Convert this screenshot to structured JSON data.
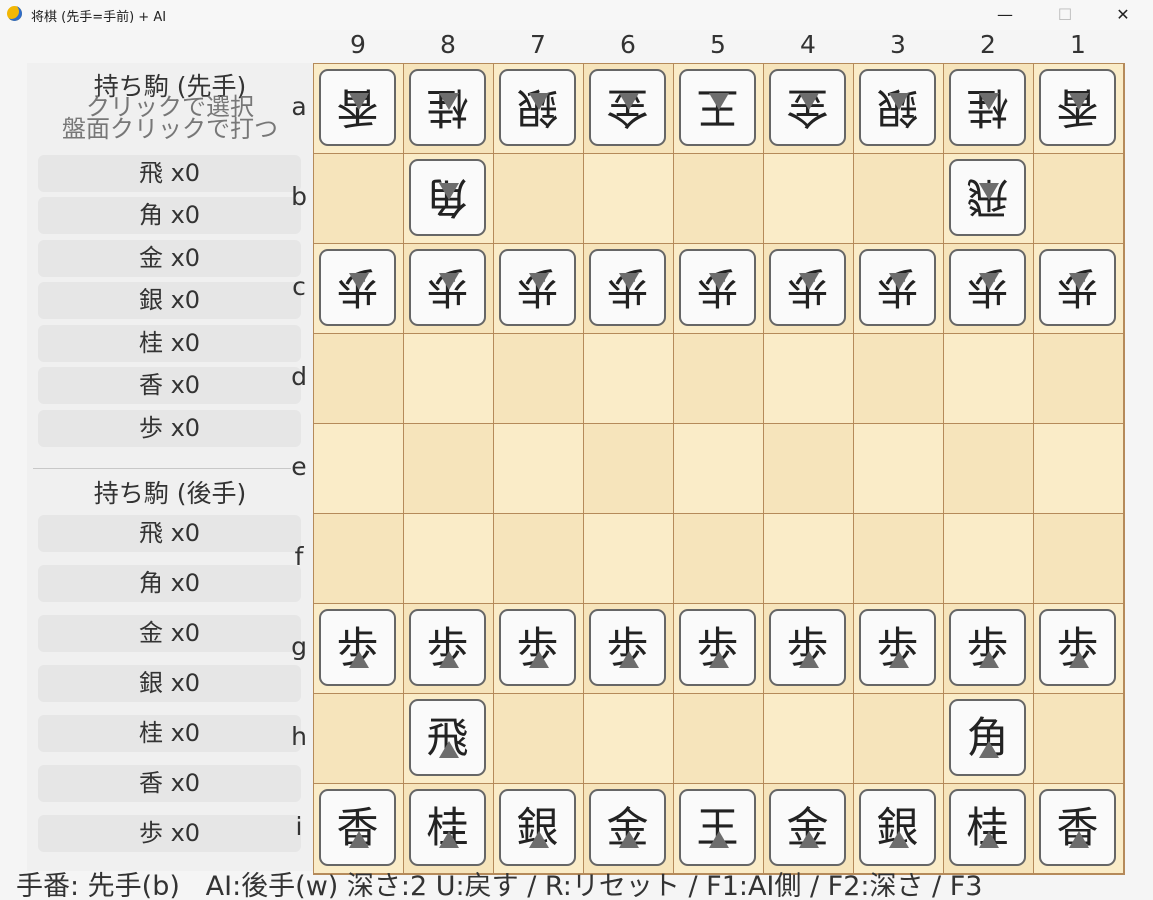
{
  "window": {
    "title": "将棋 (先手=手前) + AI",
    "minimize_label": "—",
    "maximize_label": "☐",
    "close_label": "✕",
    "app_icon": "python-icon"
  },
  "files": [
    "9",
    "8",
    "7",
    "6",
    "5",
    "4",
    "3",
    "2",
    "1"
  ],
  "ranks": [
    "a",
    "b",
    "c",
    "d",
    "e",
    "f",
    "g",
    "h",
    "i"
  ],
  "board": [
    [
      {
        "k": "香",
        "s": "gote"
      },
      {
        "k": "桂",
        "s": "gote"
      },
      {
        "k": "銀",
        "s": "gote"
      },
      {
        "k": "金",
        "s": "gote"
      },
      {
        "k": "王",
        "s": "gote"
      },
      {
        "k": "金",
        "s": "gote"
      },
      {
        "k": "銀",
        "s": "gote"
      },
      {
        "k": "桂",
        "s": "gote"
      },
      {
        "k": "香",
        "s": "gote"
      }
    ],
    [
      null,
      {
        "k": "角",
        "s": "gote"
      },
      null,
      null,
      null,
      null,
      null,
      {
        "k": "飛",
        "s": "gote"
      },
      null
    ],
    [
      {
        "k": "歩",
        "s": "gote"
      },
      {
        "k": "歩",
        "s": "gote"
      },
      {
        "k": "歩",
        "s": "gote"
      },
      {
        "k": "歩",
        "s": "gote"
      },
      {
        "k": "歩",
        "s": "gote"
      },
      {
        "k": "歩",
        "s": "gote"
      },
      {
        "k": "歩",
        "s": "gote"
      },
      {
        "k": "歩",
        "s": "gote"
      },
      {
        "k": "歩",
        "s": "gote"
      }
    ],
    [
      null,
      null,
      null,
      null,
      null,
      null,
      null,
      null,
      null
    ],
    [
      null,
      null,
      null,
      null,
      null,
      null,
      null,
      null,
      null
    ],
    [
      null,
      null,
      null,
      null,
      null,
      null,
      null,
      null,
      null
    ],
    [
      {
        "k": "歩",
        "s": "sente"
      },
      {
        "k": "歩",
        "s": "sente"
      },
      {
        "k": "歩",
        "s": "sente"
      },
      {
        "k": "歩",
        "s": "sente"
      },
      {
        "k": "歩",
        "s": "sente"
      },
      {
        "k": "歩",
        "s": "sente"
      },
      {
        "k": "歩",
        "s": "sente"
      },
      {
        "k": "歩",
        "s": "sente"
      },
      {
        "k": "歩",
        "s": "sente"
      }
    ],
    [
      null,
      {
        "k": "飛",
        "s": "sente"
      },
      null,
      null,
      null,
      null,
      null,
      {
        "k": "角",
        "s": "sente"
      },
      null
    ],
    [
      {
        "k": "香",
        "s": "sente"
      },
      {
        "k": "桂",
        "s": "sente"
      },
      {
        "k": "銀",
        "s": "sente"
      },
      {
        "k": "金",
        "s": "sente"
      },
      {
        "k": "王",
        "s": "sente"
      },
      {
        "k": "金",
        "s": "sente"
      },
      {
        "k": "銀",
        "s": "sente"
      },
      {
        "k": "桂",
        "s": "sente"
      },
      {
        "k": "香",
        "s": "sente"
      }
    ]
  ],
  "sente_hand": {
    "title": "持ち駒 (先手)",
    "hint_line1": "クリックで選択",
    "hint_line2": "盤面クリックで打つ",
    "items": [
      "飛 x0",
      "角 x0",
      "金 x0",
      "銀 x0",
      "桂 x0",
      "香 x0",
      "歩 x0"
    ]
  },
  "gote_hand": {
    "title": "持ち駒 (後手)",
    "items": [
      "飛 x0",
      "角 x0",
      "金 x0",
      "銀 x0",
      "桂 x0",
      "香 x0",
      "歩 x0"
    ]
  },
  "status": "手番: 先手(b)   AI:後手(w) 深さ:2  U:戻す / R:リセット / F1:AI側 / F2:深さ / F3"
}
